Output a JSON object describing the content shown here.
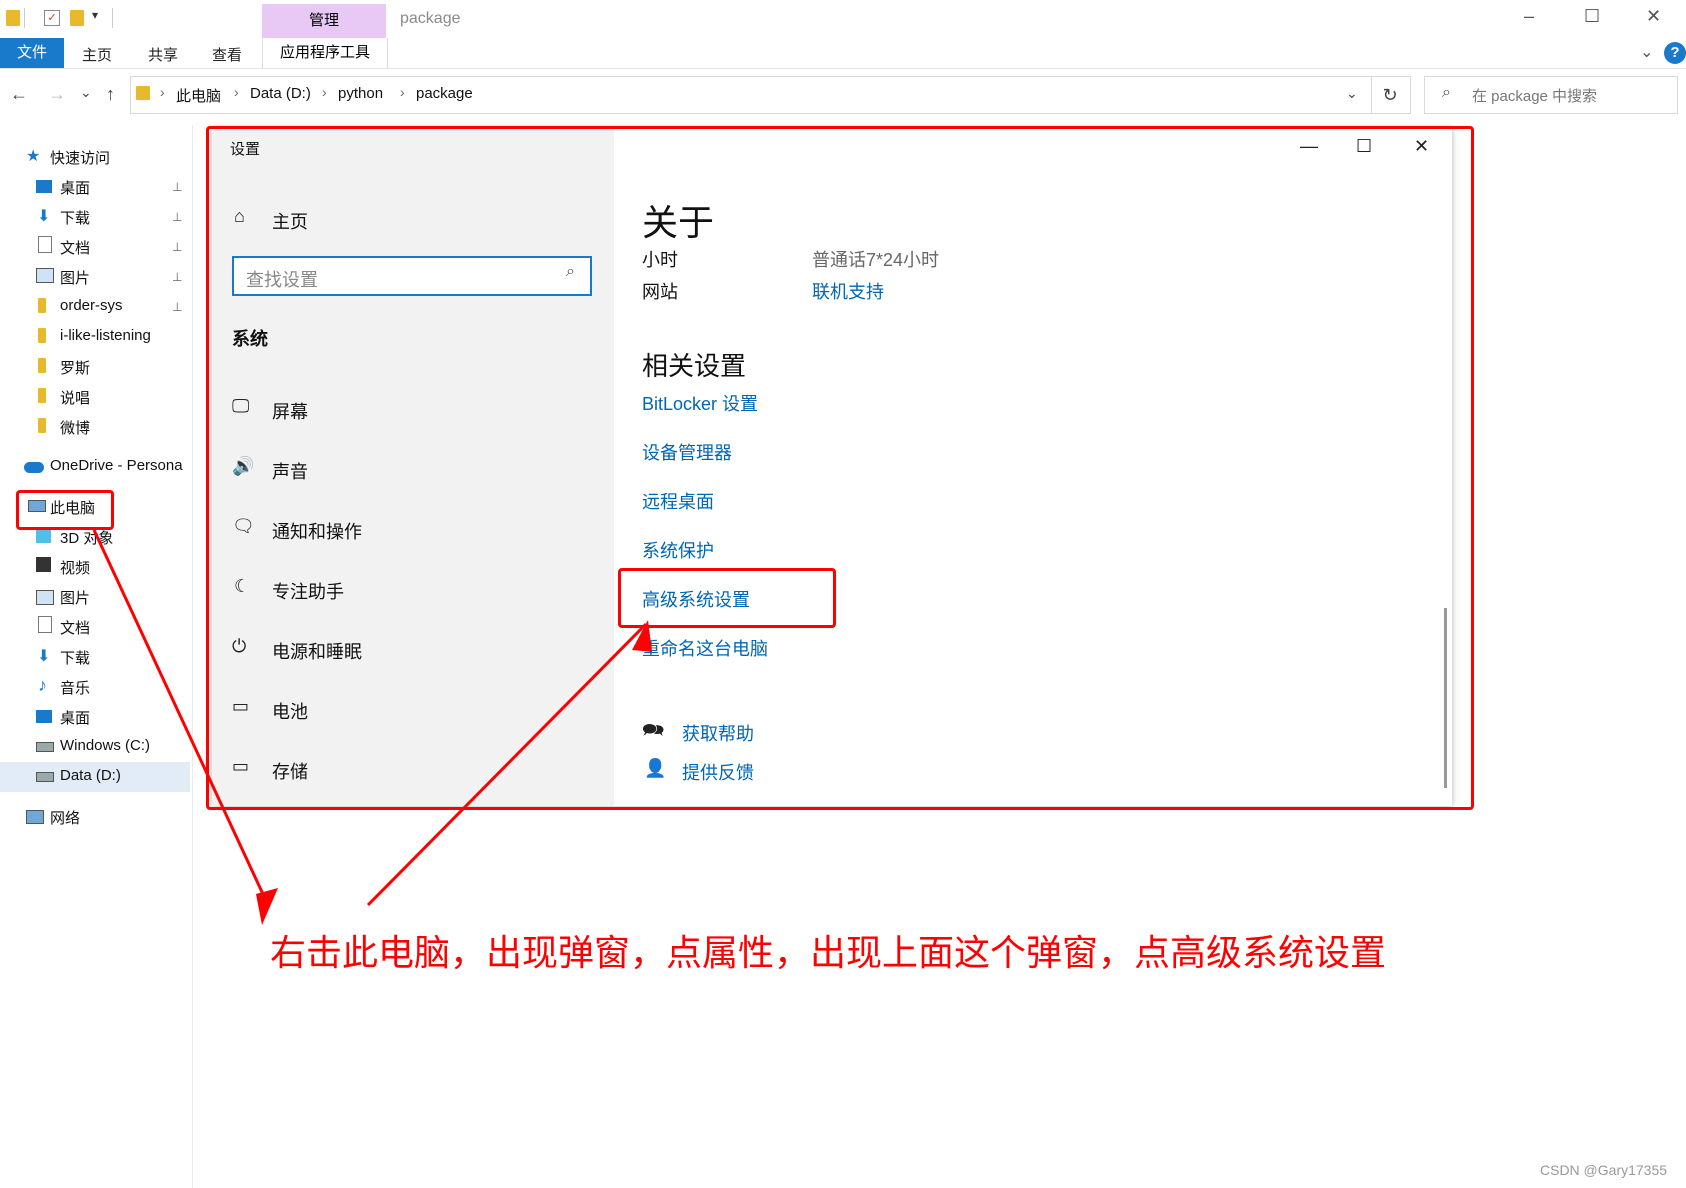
{
  "window": {
    "title": "package",
    "contextual_tab": "管理",
    "controls": {
      "minimize": "–",
      "maximize": "☐",
      "close": "✕"
    }
  },
  "ribbon": {
    "tabs": [
      "文件",
      "主页",
      "共享",
      "查看",
      "应用程序工具"
    ],
    "help": "?",
    "collapse": "⌄"
  },
  "address": {
    "back": "←",
    "forward": "→",
    "recent": "⌄",
    "up": "↑",
    "breadcrumbs": [
      "此电脑",
      "Data (D:)",
      "python",
      "package"
    ],
    "refresh": "↻",
    "search_icon": "⌕",
    "search_placeholder": "在 package 中搜索"
  },
  "nav": {
    "quick_access": "快速访问",
    "quick_items": [
      "桌面",
      "下载",
      "文档",
      "图片",
      "order-sys",
      "i-like-listening",
      "罗斯",
      "说唱",
      "微博"
    ],
    "onedrive": "OneDrive - Persona",
    "this_pc": "此电脑",
    "pc_items": [
      "3D 对象",
      "视频",
      "图片",
      "文档",
      "下载",
      "音乐",
      "桌面",
      "Windows (C:)",
      "Data (D:)"
    ],
    "network": "网络",
    "pin_glyph": "📌"
  },
  "settings": {
    "title": "设置",
    "home": "主页",
    "search_placeholder": "查找设置",
    "search_icon": "⌕",
    "section": "系统",
    "side_items": [
      {
        "label": "屏幕",
        "icon": "🖵"
      },
      {
        "label": "声音",
        "icon": "🔊"
      },
      {
        "label": "通知和操作",
        "icon": "🗨"
      },
      {
        "label": "专注助手",
        "icon": "☾"
      },
      {
        "label": "电源和睡眠",
        "icon": "⏻"
      },
      {
        "label": "电池",
        "icon": "▭"
      },
      {
        "label": "存储",
        "icon": "▭"
      }
    ],
    "home_icon": "⌂",
    "about_title": "关于",
    "hours_label": "小时",
    "hours_value": "普通话7*24小时",
    "website_label": "网站",
    "website_link": "联机支持",
    "related_title": "相关设置",
    "related_links": [
      "BitLocker 设置",
      "设备管理器",
      "远程桌面",
      "系统保护",
      "高级系统设置",
      "重命名这台电脑"
    ],
    "help_link": "获取帮助",
    "feedback_link": "提供反馈",
    "controls": {
      "minimize": "—",
      "maximize": "☐",
      "close": "✕"
    }
  },
  "annotation": {
    "text": "右击此电脑，出现弹窗，点属性，出现上面这个弹窗，点高级系统设置"
  },
  "watermark": "CSDN @Gary17355",
  "colors": {
    "accent": "#1979ca",
    "link": "#0066b4",
    "annotation": "#ff0000"
  }
}
